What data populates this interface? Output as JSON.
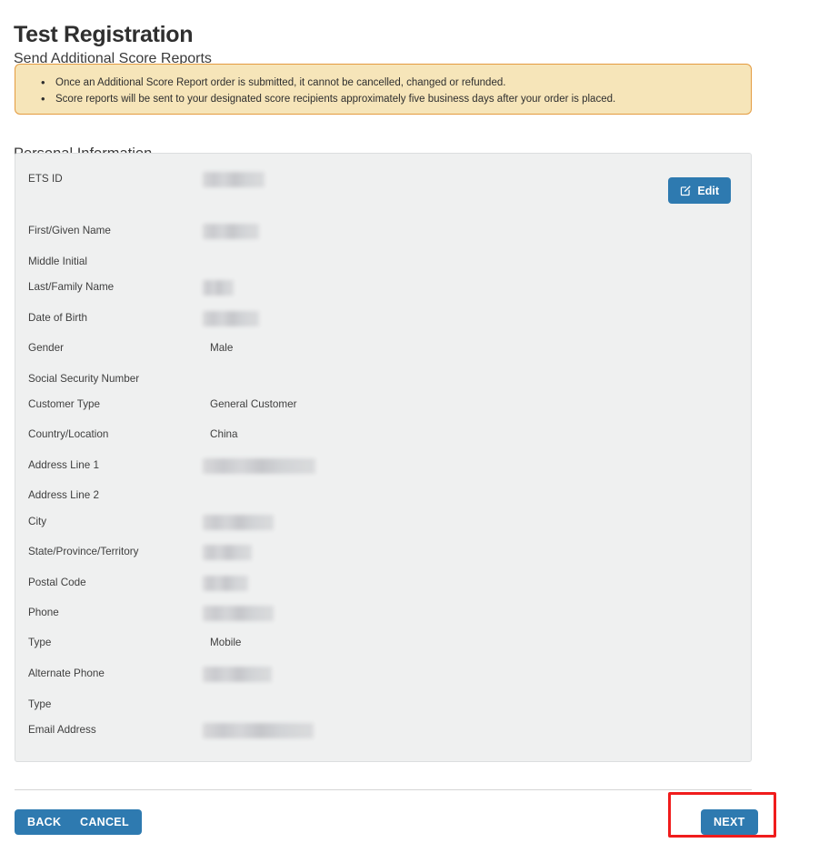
{
  "header": {
    "title": "Test Registration",
    "subtitle": "Send Additional Score Reports"
  },
  "alert": {
    "bullet_glyph": "•",
    "items": [
      "Once an Additional Score Report order is submitted, it cannot be cancelled, changed or refunded.",
      "Score reports will be sent to your designated score recipients approximately five business days after your order is placed."
    ]
  },
  "section": {
    "title": "Personal Information",
    "edit_button": {
      "label": "Edit",
      "icon": "edit-pencil-square-icon"
    },
    "fields": [
      {
        "label": "ETS ID",
        "value": "",
        "redacted": true,
        "redacted_width": 68
      },
      {
        "label": "First/Given Name",
        "value": "",
        "redacted": true,
        "redacted_width": 62
      },
      {
        "label": "Middle Initial",
        "value": "",
        "redacted": false,
        "redacted_width": 0
      },
      {
        "label": "Last/Family Name",
        "value": "",
        "redacted": true,
        "redacted_width": 34
      },
      {
        "label": "Date of Birth",
        "value": "",
        "redacted": true,
        "redacted_width": 62
      },
      {
        "label": "Gender",
        "value": "Male",
        "redacted": false,
        "redacted_width": 0
      },
      {
        "label": "Social Security Number",
        "value": "",
        "redacted": false,
        "redacted_width": 0
      },
      {
        "label": "Customer Type",
        "value": "General Customer",
        "redacted": false,
        "redacted_width": 0
      },
      {
        "label": "Country/Location",
        "value": "China",
        "redacted": false,
        "redacted_width": 0
      },
      {
        "label": "Address Line 1",
        "value": "",
        "redacted": true,
        "redacted_width": 124
      },
      {
        "label": "Address Line 2",
        "value": "",
        "redacted": false,
        "redacted_width": 0
      },
      {
        "label": "City",
        "value": "",
        "redacted": true,
        "redacted_width": 78
      },
      {
        "label": "State/Province/Territory",
        "value": "",
        "redacted": true,
        "redacted_width": 54
      },
      {
        "label": "Postal Code",
        "value": "",
        "redacted": true,
        "redacted_width": 50
      },
      {
        "label": "Phone",
        "value": "",
        "redacted": true,
        "redacted_width": 78
      },
      {
        "label": "Type",
        "value": "Mobile",
        "redacted": false,
        "redacted_width": 0
      },
      {
        "label": "Alternate Phone",
        "value": "",
        "redacted": true,
        "redacted_width": 76
      },
      {
        "label": "Type",
        "value": "",
        "redacted": false,
        "redacted_width": 0
      },
      {
        "label": "Email Address",
        "value": "",
        "redacted": true,
        "redacted_width": 122
      }
    ]
  },
  "footer": {
    "back_label": "BACK",
    "cancel_label": "CANCEL",
    "next_label": "NEXT"
  },
  "annotation": {
    "target": "next-button",
    "color": "#f01c1c"
  },
  "colors": {
    "accent_blue": "#2e7ab0",
    "alert_bg": "#f6e5b9",
    "alert_border": "#e49b3f",
    "panel_bg": "#eff0f0",
    "panel_border": "#dcdedf",
    "highlight_red": "#f01c1c"
  }
}
